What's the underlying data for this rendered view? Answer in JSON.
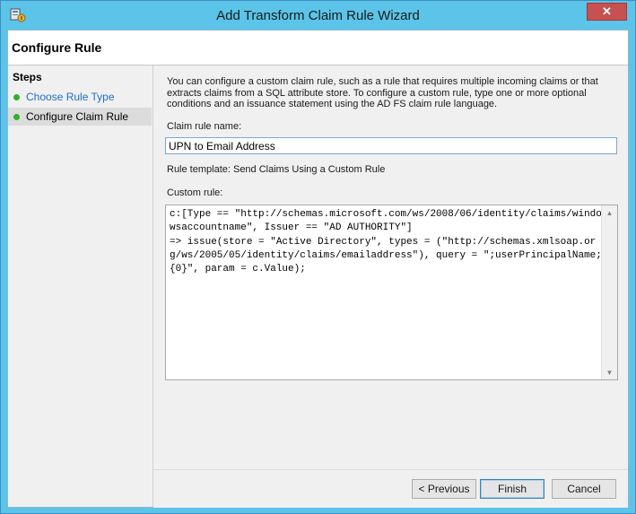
{
  "window": {
    "title": "Add Transform Claim Rule Wizard",
    "close_glyph": "✕"
  },
  "header": {
    "title": "Configure Rule"
  },
  "steps": {
    "title": "Steps",
    "items": [
      {
        "label": "Choose Rule Type",
        "status": "complete",
        "current": false
      },
      {
        "label": "Configure Claim Rule",
        "status": "complete",
        "current": true
      }
    ]
  },
  "content": {
    "intro": "You can configure a custom claim rule, such as a rule that requires multiple incoming claims or that extracts claims from a SQL attribute store. To configure a custom rule, type one or more optional conditions and an issuance statement using the AD FS claim rule language.",
    "claim_rule_name_label": "Claim rule name:",
    "claim_rule_name_value": "UPN to Email Address",
    "rule_template": "Rule template: Send Claims Using a Custom Rule",
    "custom_rule_label": "Custom rule:",
    "custom_rule_value": "c:[Type == \"http://schemas.microsoft.com/ws/2008/06/identity/claims/windowsaccountname\", Issuer == \"AD AUTHORITY\"]\n=> issue(store = \"Active Directory\", types = (\"http://schemas.xmlsoap.org/ws/2005/05/identity/claims/emailaddress\"), query = \";userPrincipalName;{0}\", param = c.Value);"
  },
  "footer": {
    "previous_label": "< Previous",
    "finish_label": "Finish",
    "cancel_label": "Cancel"
  },
  "colors": {
    "titlebar": "#5bc4e8",
    "close_button": "#c75050",
    "step_complete": "#2fb12f",
    "link_step": "#1e6ec8"
  }
}
